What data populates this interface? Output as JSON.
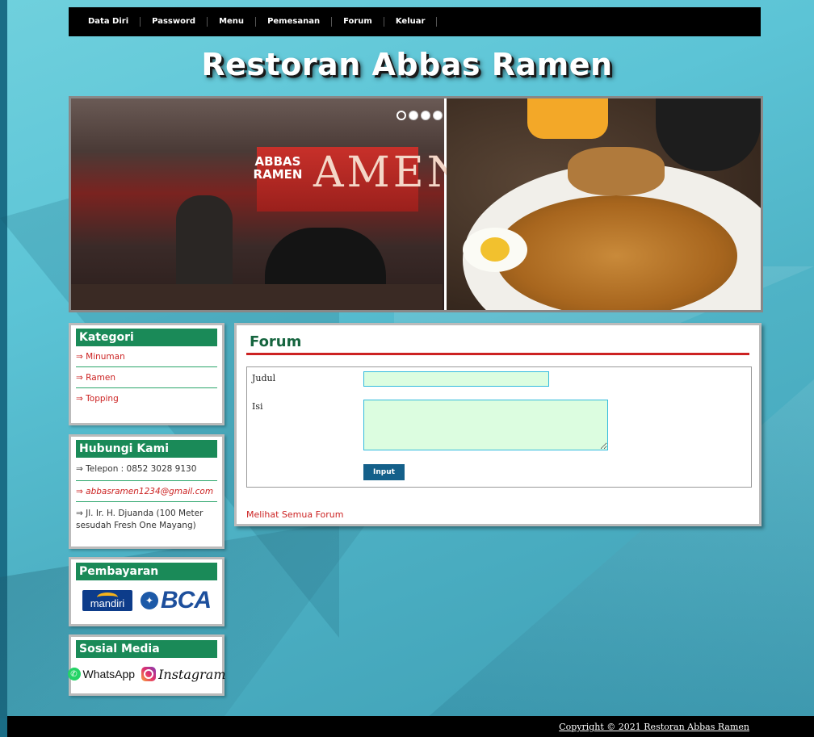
{
  "nav": {
    "items": [
      "Data Diri",
      "Password",
      "Menu",
      "Pemesanan",
      "Forum",
      "Keluar"
    ]
  },
  "site_title": "Restoran Abbas Ramen",
  "banner": {
    "awning_text": "AMEN",
    "sign_text": "ABBAS RAMEN",
    "active_slide": 1,
    "slide_count": 4
  },
  "kategori": {
    "title": "Kategori",
    "items": [
      "⇒ Minuman",
      "⇒ Ramen",
      "⇒ Topping"
    ]
  },
  "kontak": {
    "title": "Hubungi Kami",
    "phone": "⇒ Telepon : 0852 3028 9130",
    "email": "⇒ abbasramen1234@gmail.com",
    "address": "⇒ Jl. Ir. H. Djuanda (100 Meter sesudah Fresh One Mayang)"
  },
  "pembayaran": {
    "title": "Pembayaran",
    "bank1": "mandiri",
    "bank2": "BCA"
  },
  "sosial": {
    "title": "Sosial Media",
    "whatsapp": "WhatsApp",
    "instagram": "Instagram"
  },
  "forum": {
    "title": "Forum",
    "label_judul": "Judul",
    "label_isi": "Isi",
    "judul_value": "",
    "isi_value": "",
    "submit_label": "Input",
    "view_all_link": "Melihat Semua Forum"
  },
  "footer": {
    "copyright": "Copyright © 2021 Restoran Abbas Ramen"
  },
  "colors": {
    "accent_green": "#1a8a58",
    "accent_red": "#cc2222",
    "button_blue": "#14608a",
    "input_bg": "#dcfde0"
  }
}
